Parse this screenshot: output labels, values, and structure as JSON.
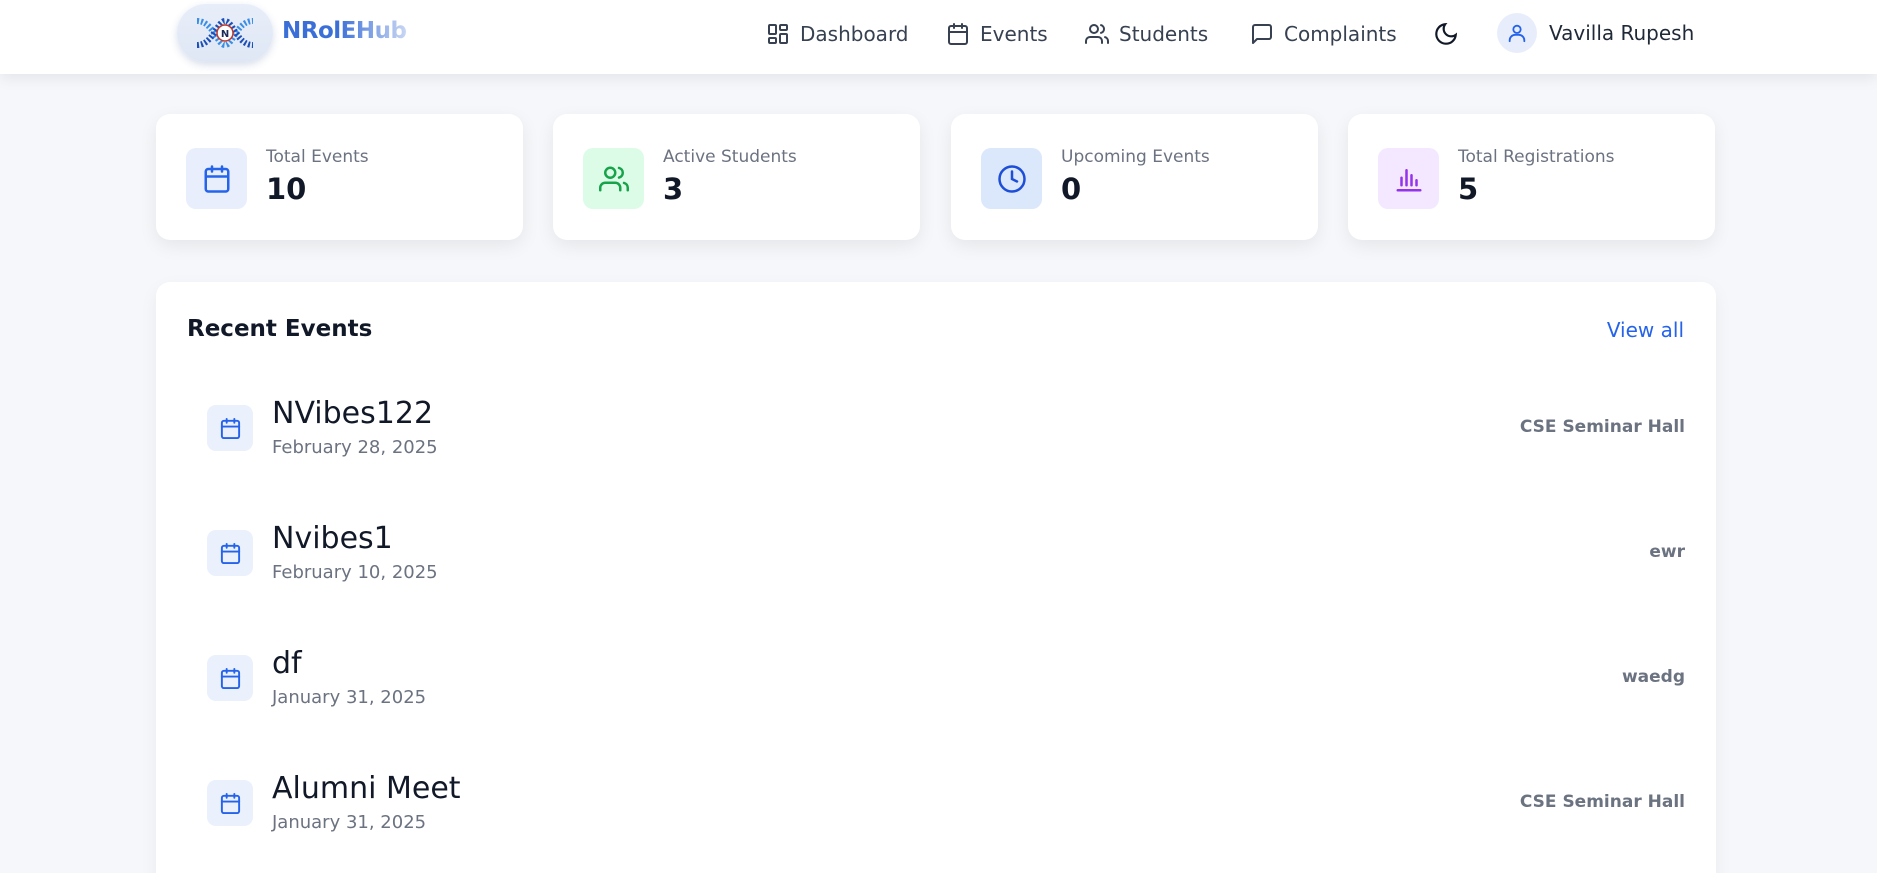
{
  "app": {
    "brand": "NRolEHub",
    "logo_text": "N"
  },
  "nav": {
    "items": [
      {
        "label": "Dashboard",
        "icon": "dashboard-grid-icon"
      },
      {
        "label": "Events",
        "icon": "calendar-icon"
      },
      {
        "label": "Students",
        "icon": "users-icon"
      },
      {
        "label": "Complaints",
        "icon": "message-square-icon"
      }
    ],
    "theme_icon": "moon-icon",
    "user": {
      "name": "Vavilla Rupesh",
      "icon": "user-icon"
    }
  },
  "stats": [
    {
      "label": "Total Events",
      "value": "10",
      "icon": "calendar-icon",
      "bg": "#e8eefb",
      "color": "#2563eb"
    },
    {
      "label": "Active Students",
      "value": "3",
      "icon": "users-icon",
      "bg": "#dcfce7",
      "color": "#16a34a"
    },
    {
      "label": "Upcoming Events",
      "value": "0",
      "icon": "clock-icon",
      "bg": "#dbe7fb",
      "color": "#1d4ed8"
    },
    {
      "label": "Total Registrations",
      "value": "5",
      "icon": "bar-chart-icon",
      "bg": "#f3e8ff",
      "color": "#9333ea"
    }
  ],
  "recent_events": {
    "title": "Recent Events",
    "view_all": "View all",
    "items": [
      {
        "name": "NVibes122",
        "date": "February 28, 2025",
        "venue": "CSE Seminar Hall"
      },
      {
        "name": "Nvibes1",
        "date": "February 10, 2025",
        "venue": "ewr"
      },
      {
        "name": "df",
        "date": "January 31, 2025",
        "venue": "waedg"
      },
      {
        "name": "Alumni Meet",
        "date": "January 31, 2025",
        "venue": "CSE Seminar Hall"
      }
    ]
  },
  "colors": {
    "accent": "#2563eb",
    "background": "#f5f7fa"
  }
}
